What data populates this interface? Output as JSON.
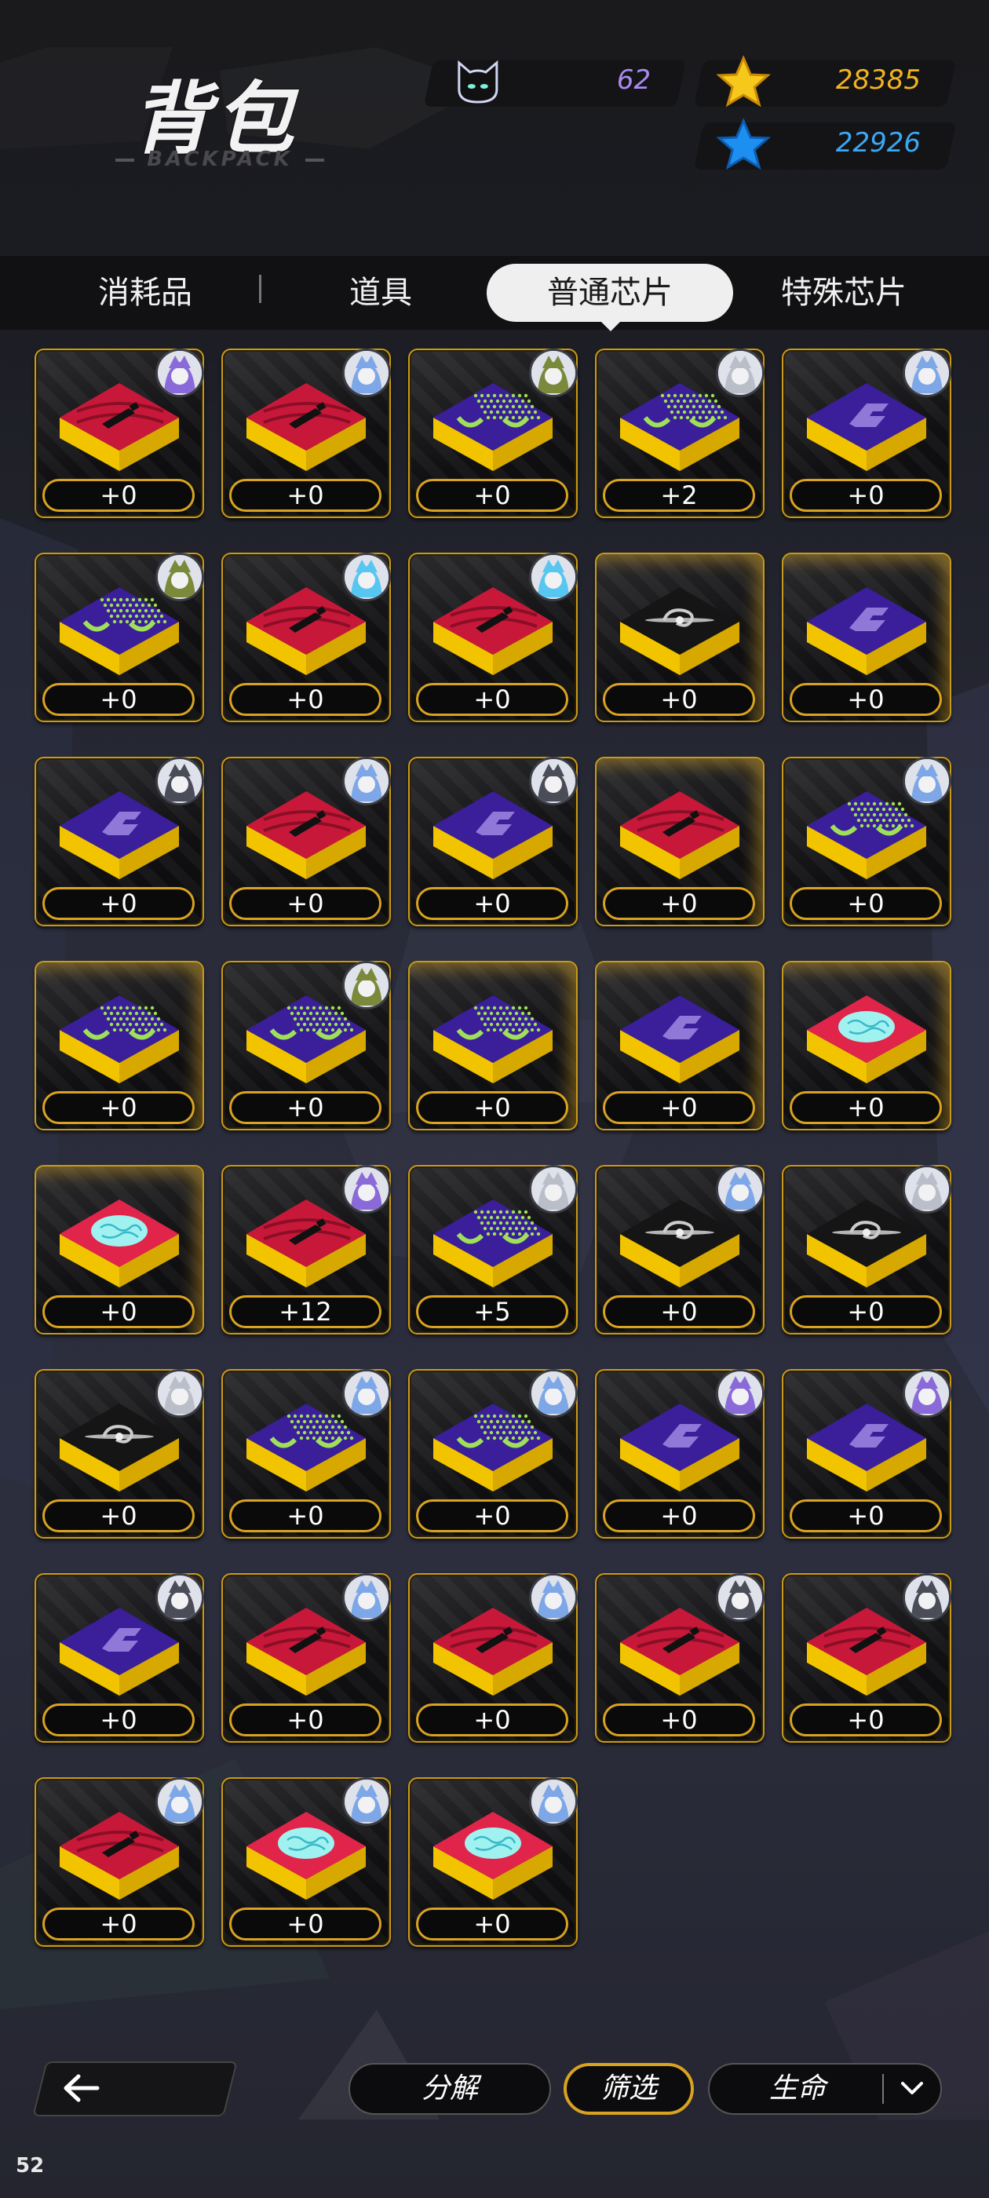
{
  "header": {
    "title": "背包",
    "subtitle": "BACKPACK",
    "resources": {
      "cat_count": "62",
      "gold_stars": "28385",
      "blue_stars": "22926"
    }
  },
  "tabs": [
    {
      "label": "消耗品",
      "active": false
    },
    {
      "label": "道具",
      "active": false
    },
    {
      "label": "普通芯片",
      "active": true
    },
    {
      "label": "特殊芯片",
      "active": false
    }
  ],
  "items": [
    {
      "chip": "red-bottle",
      "level": "+0",
      "avatar": "purple",
      "gold": false
    },
    {
      "chip": "red-bottle",
      "level": "+0",
      "avatar": "blue",
      "gold": false
    },
    {
      "chip": "purple-dots",
      "level": "+0",
      "avatar": "green",
      "gold": false
    },
    {
      "chip": "purple-dots",
      "level": "+2",
      "avatar": "grey",
      "gold": false
    },
    {
      "chip": "purple-logo",
      "level": "+0",
      "avatar": "blue",
      "gold": false
    },
    {
      "chip": "purple-dots",
      "level": "+0",
      "avatar": "green",
      "gold": false
    },
    {
      "chip": "red-bottle",
      "level": "+0",
      "avatar": "cyan",
      "gold": false
    },
    {
      "chip": "red-bottle",
      "level": "+0",
      "avatar": "cyan",
      "gold": false
    },
    {
      "chip": "black-vortex",
      "level": "+0",
      "avatar": "",
      "gold": true
    },
    {
      "chip": "purple-logo",
      "level": "+0",
      "avatar": "",
      "gold": true
    },
    {
      "chip": "purple-logo",
      "level": "+0",
      "avatar": "dark",
      "gold": false
    },
    {
      "chip": "red-bottle",
      "level": "+0",
      "avatar": "blue",
      "gold": false
    },
    {
      "chip": "purple-logo",
      "level": "+0",
      "avatar": "dark",
      "gold": false
    },
    {
      "chip": "red-bottle",
      "level": "+0",
      "avatar": "",
      "gold": true
    },
    {
      "chip": "purple-dots",
      "level": "+0",
      "avatar": "blue",
      "gold": false
    },
    {
      "chip": "purple-dots",
      "level": "+0",
      "avatar": "",
      "gold": true
    },
    {
      "chip": "purple-dots",
      "level": "+0",
      "avatar": "green",
      "gold": false
    },
    {
      "chip": "purple-dots",
      "level": "+0",
      "avatar": "",
      "gold": true
    },
    {
      "chip": "purple-logo",
      "level": "+0",
      "avatar": "",
      "gold": true
    },
    {
      "chip": "red-brain",
      "level": "+0",
      "avatar": "",
      "gold": true
    },
    {
      "chip": "red-brain",
      "level": "+0",
      "avatar": "",
      "gold": true
    },
    {
      "chip": "red-bottle",
      "level": "+12",
      "avatar": "purple",
      "gold": false
    },
    {
      "chip": "purple-dots",
      "level": "+5",
      "avatar": "grey",
      "gold": false
    },
    {
      "chip": "black-vortex",
      "level": "+0",
      "avatar": "blue",
      "gold": false
    },
    {
      "chip": "black-vortex",
      "level": "+0",
      "avatar": "grey",
      "gold": false
    },
    {
      "chip": "black-vortex",
      "level": "+0",
      "avatar": "grey",
      "gold": false
    },
    {
      "chip": "purple-dots",
      "level": "+0",
      "avatar": "blue",
      "gold": false
    },
    {
      "chip": "purple-dots",
      "level": "+0",
      "avatar": "blue",
      "gold": false
    },
    {
      "chip": "purple-logo",
      "level": "+0",
      "avatar": "purple",
      "gold": false
    },
    {
      "chip": "purple-logo",
      "level": "+0",
      "avatar": "purple",
      "gold": false
    },
    {
      "chip": "purple-logo",
      "level": "+0",
      "avatar": "dark",
      "gold": false
    },
    {
      "chip": "red-bottle",
      "level": "+0",
      "avatar": "blue",
      "gold": false
    },
    {
      "chip": "red-bottle",
      "level": "+0",
      "avatar": "blue",
      "gold": false
    },
    {
      "chip": "red-bottle",
      "level": "+0",
      "avatar": "dark",
      "gold": false
    },
    {
      "chip": "red-bottle",
      "level": "+0",
      "avatar": "dark",
      "gold": false
    },
    {
      "chip": "red-bottle",
      "level": "+0",
      "avatar": "blue",
      "gold": false
    },
    {
      "chip": "red-brain",
      "level": "+0",
      "avatar": "blue",
      "gold": false
    },
    {
      "chip": "red-brain",
      "level": "+0",
      "avatar": "blue",
      "gold": false
    }
  ],
  "bottom_bar": {
    "back_icon": "arrow-left-icon",
    "decompose_label": "分解",
    "filter_label": "筛选",
    "sort_label": "生命",
    "sort_icon": "chevron-down-icon"
  },
  "fps": "52",
  "colors": {
    "gold": "#d9a320",
    "chip_red": "#c8183a",
    "chip_purple": "#3a1e9a",
    "chip_yellow": "#f2c400",
    "dots_green": "#9fe05a",
    "cat_purple": "#a98bf0",
    "gold_text": "#f2b320",
    "blue_text": "#3aa8f5"
  }
}
